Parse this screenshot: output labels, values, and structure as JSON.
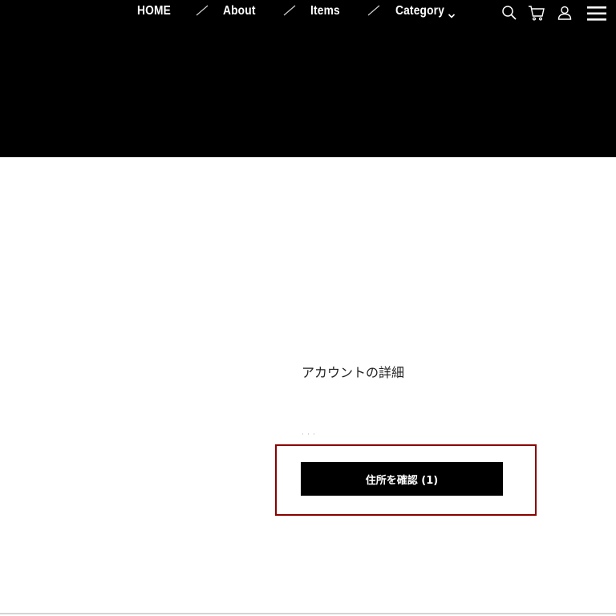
{
  "nav": {
    "items": [
      {
        "label": "HOME"
      },
      {
        "label": "About"
      },
      {
        "label": "Items"
      },
      {
        "label": "Category"
      }
    ]
  },
  "header_icons": [
    "search-icon",
    "cart-icon",
    "user-icon",
    "menu-icon"
  ],
  "account": {
    "title": "アカウントの詳細",
    "placeholder_dots": "· · ·",
    "confirm_button": "住所を確認 (1)"
  },
  "colors": {
    "header_bg": "#000000",
    "highlight_border": "#8b0000",
    "button_bg": "#000000",
    "button_text": "#ffffff"
  }
}
